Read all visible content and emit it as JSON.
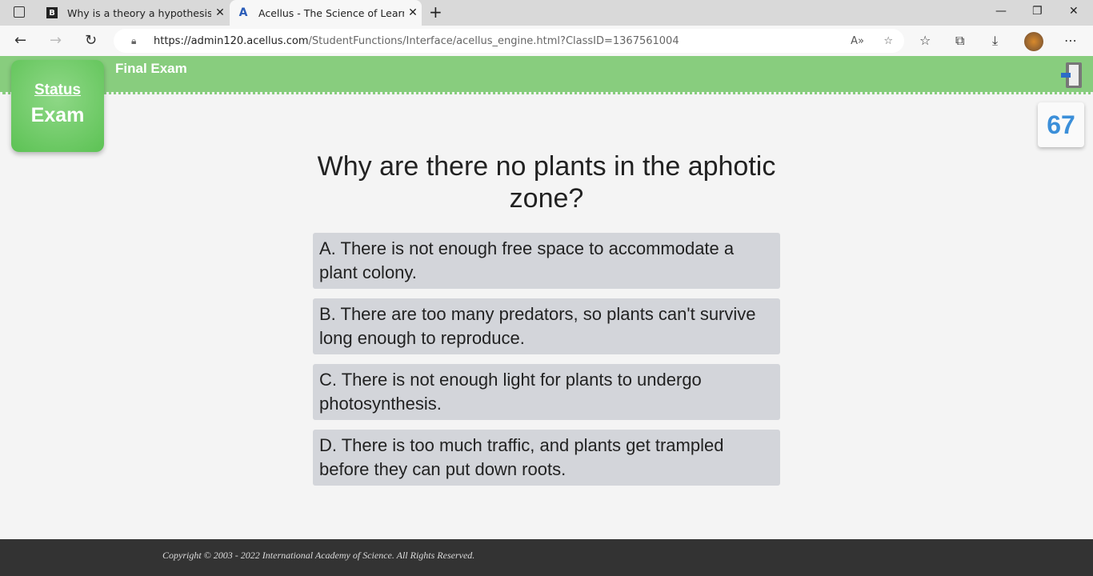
{
  "browser": {
    "tabs": [
      {
        "title": "Why is a theory a hypothesis? - B",
        "icon": "B"
      },
      {
        "title": "Acellus - The Science of Learning",
        "icon": "A"
      }
    ],
    "url_host": "https://admin120.acellus.com",
    "url_path": "/StudentFunctions/Interface/acellus_engine.html?ClassID=1367561004"
  },
  "header": {
    "title": "Final Exam",
    "status_label": "Status",
    "status_value": "Exam",
    "counter": "67"
  },
  "question": "Why are there no plants in the aphotic zone?",
  "answers": [
    "A.  There is not enough free space to accommodate a plant colony.",
    "B.  There are too many predators, so plants can't survive long enough to reproduce.",
    "C.  There is not enough light for plants to undergo photosynthesis.",
    "D.  There is too much traffic, and plants get trampled before they can put down roots."
  ],
  "footer": "Copyright © 2003 - 2022 International Academy of Science.  All Rights Reserved."
}
